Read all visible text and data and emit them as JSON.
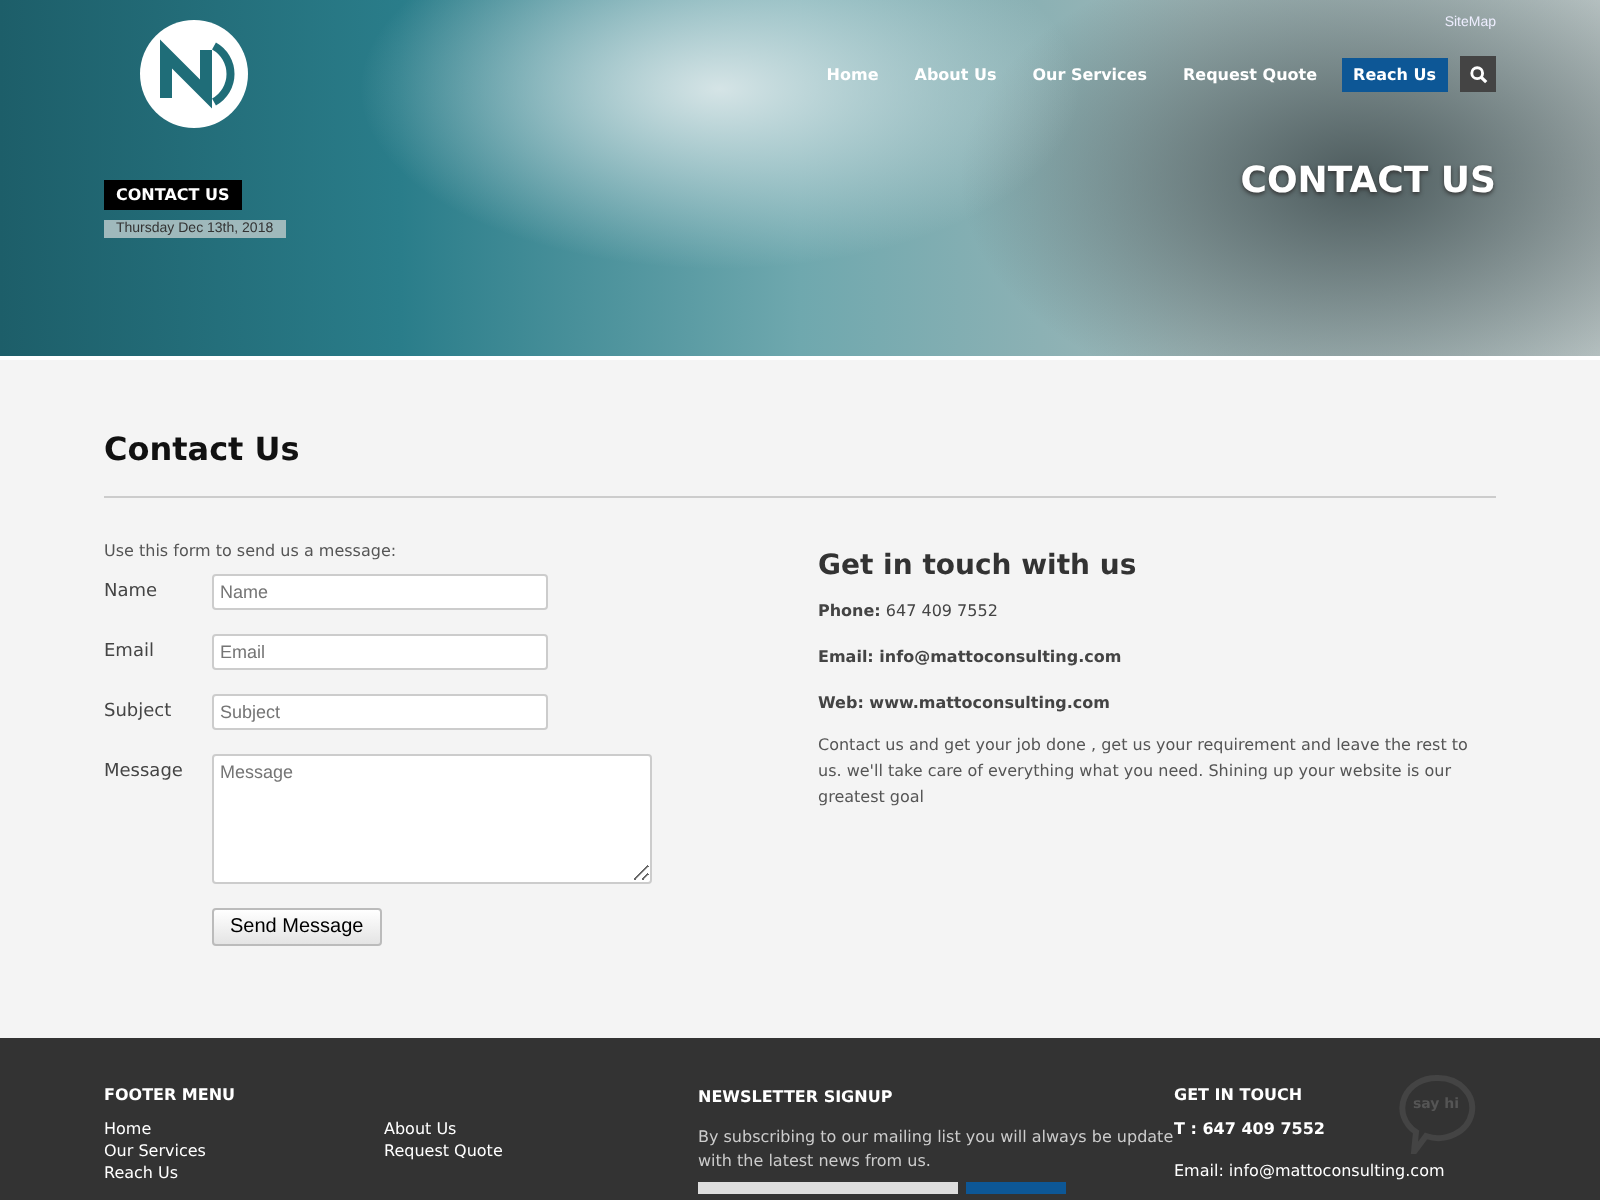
{
  "header": {
    "sitemap": "SiteMap",
    "nav": [
      {
        "label": "Home",
        "selected": false
      },
      {
        "label": "About Us",
        "selected": false
      },
      {
        "label": "Our Services",
        "selected": false
      },
      {
        "label": "Request Quote",
        "selected": false
      },
      {
        "label": "Reach Us",
        "selected": true
      }
    ],
    "breadcrumb": "CONTACT US",
    "date": "Thursday Dec 13th, 2018",
    "page_title": "CONTACT US"
  },
  "main": {
    "title": "Contact Us",
    "form": {
      "intro": "Use this form to send us a message:",
      "fields": [
        {
          "label": "Name",
          "placeholder": "Name",
          "kind": "input"
        },
        {
          "label": "Email",
          "placeholder": "Email",
          "kind": "input"
        },
        {
          "label": "Subject",
          "placeholder": "Subject",
          "kind": "input"
        },
        {
          "label": "Message",
          "placeholder": "Message",
          "kind": "textarea"
        }
      ],
      "submit": "Send Message"
    },
    "contact": {
      "title": "Get in touch with us",
      "lines": [
        "**Phone:** 647 409 7552",
        "**Email: info@mattoconsulting.com**",
        "**Web: www.mattoconsulting.com**"
      ],
      "text": "Contact us and get your job done , get us your requirement and leave the rest to us. we'll take care of everything what you need. Shining up your website is our greatest goal"
    }
  },
  "footer": {
    "menu": {
      "title": "FOOTER MENU",
      "col_1": [
        "Home",
        "Our Services",
        "Reach Us"
      ],
      "col_2": [
        "About Us",
        "Request Quote"
      ]
    },
    "newsletter": {
      "title": "NEWSLETTER SIGNUP",
      "text": "By subscribing to our mailing list you will always be update with the latest news from us."
    },
    "touch": {
      "title": "GET IN TOUCH",
      "phone": "T : 647 409 7552",
      "email": "Email: info@mattoconsulting.com",
      "say_hi": "say hi"
    }
  }
}
